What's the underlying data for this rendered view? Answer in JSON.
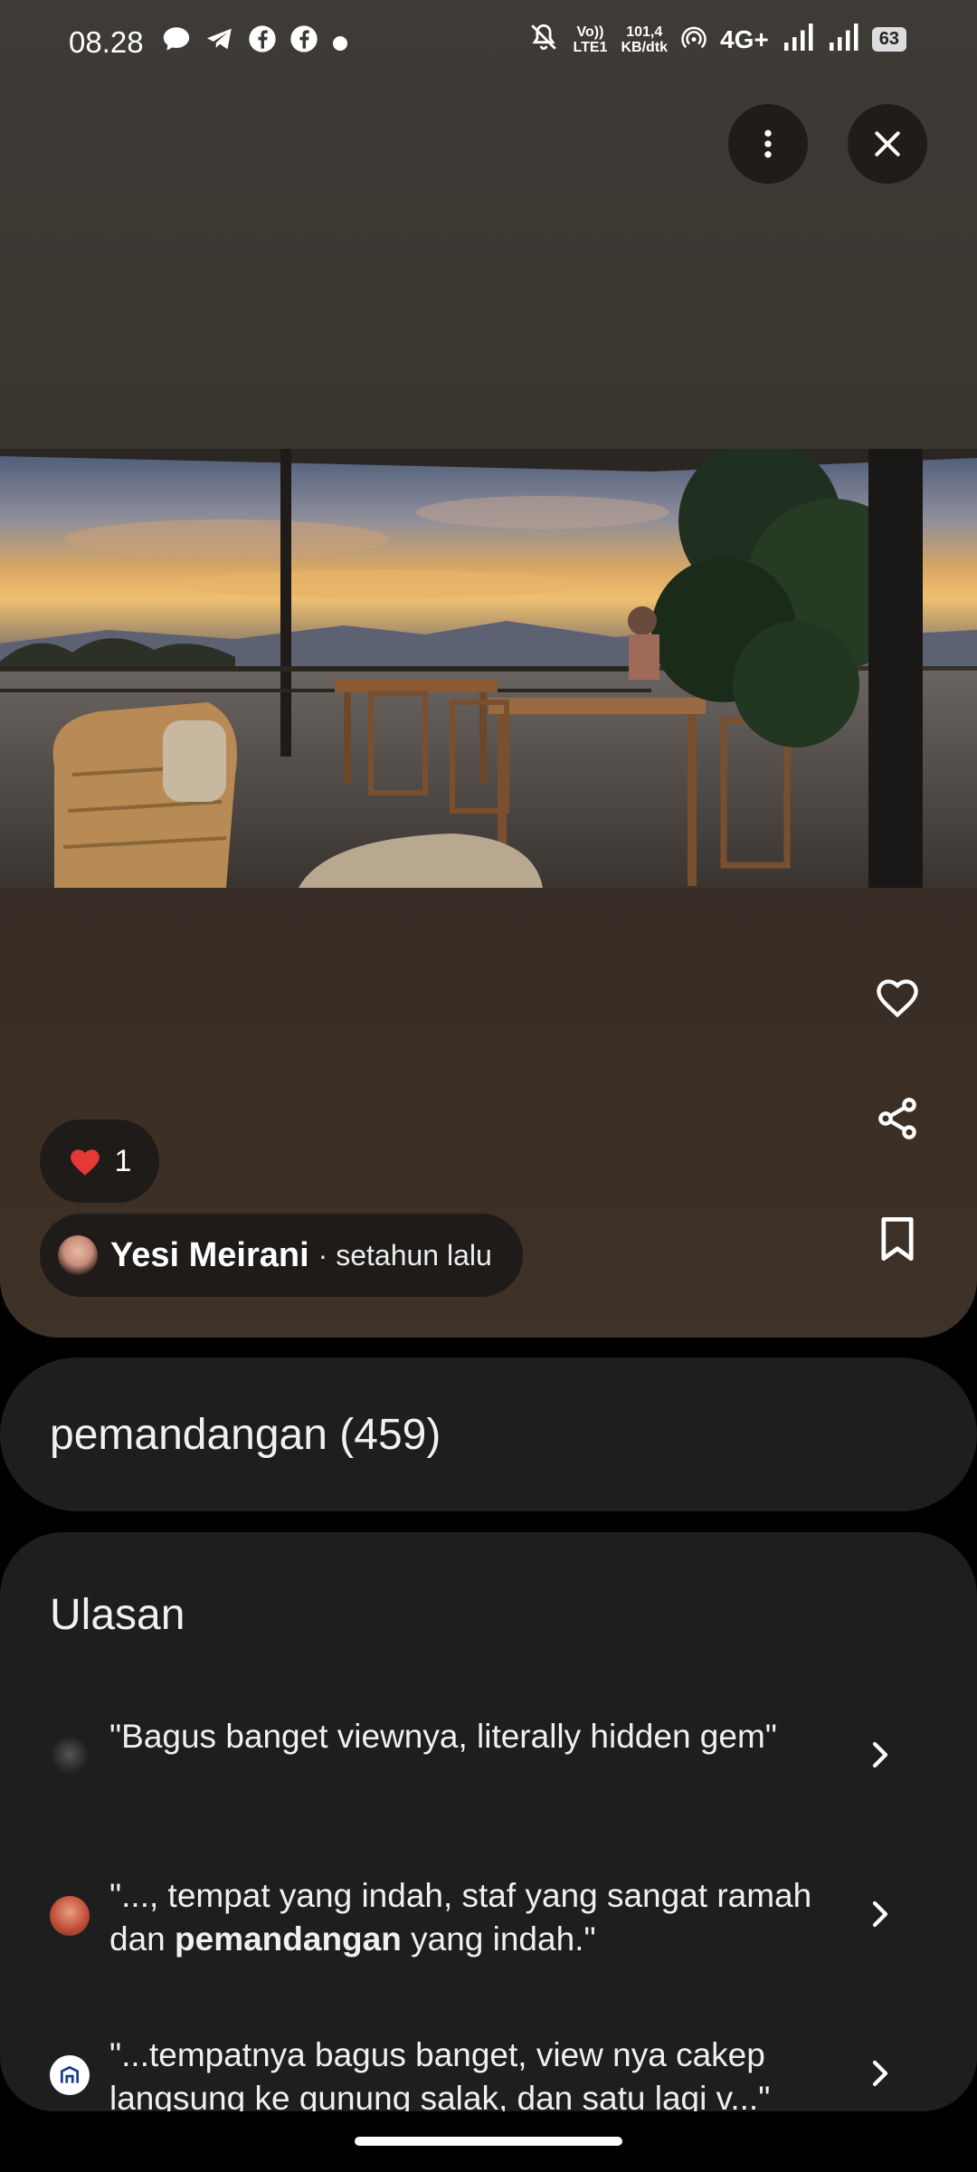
{
  "status_bar": {
    "time": "08.28",
    "left_icons": [
      "message-icon",
      "telegram-icon",
      "facebook-icon",
      "facebook-icon",
      "dot-icon"
    ],
    "volte": "Vo)) LTE1",
    "speed_value": "101,4",
    "speed_unit": "KB/dtk",
    "network": "4G+",
    "battery": "63"
  },
  "viewer": {
    "like_count": "1",
    "author": "Yesi Meirani",
    "time_ago": "· setahun lalu"
  },
  "topic": {
    "label": "pemandangan (459)"
  },
  "reviews": {
    "title": "Ulasan",
    "items": [
      {
        "text": "\"Bagus banget viewnya, literally hidden gem\""
      },
      {
        "text_before": "\"..., tempat yang indah, staf yang sangat ramah dan ",
        "text_bold": "pemandangan",
        "text_after": " yang indah.\""
      },
      {
        "text": "\"...tempatnya bagus banget, view nya cakep langsung ke gunung salak, dan satu lagi v...\""
      }
    ]
  },
  "colors": {
    "card_bg": "#1e1e1e",
    "chip_bg": "#1e1b19"
  }
}
